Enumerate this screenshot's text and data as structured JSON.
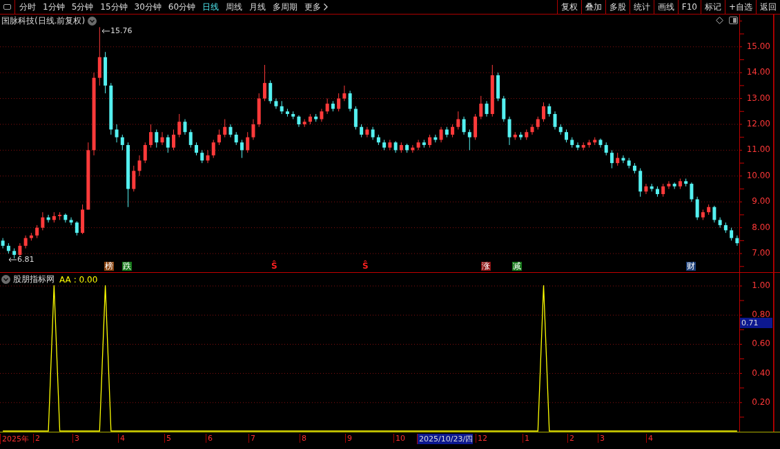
{
  "toolbar": {
    "periods": [
      {
        "label": "分时",
        "selected": false
      },
      {
        "label": "1分钟",
        "selected": false
      },
      {
        "label": "5分钟",
        "selected": false
      },
      {
        "label": "15分钟",
        "selected": false
      },
      {
        "label": "30分钟",
        "selected": false
      },
      {
        "label": "60分钟",
        "selected": false
      },
      {
        "label": "日线",
        "selected": true
      },
      {
        "label": "周线",
        "selected": false
      },
      {
        "label": "月线",
        "selected": false
      },
      {
        "label": "多周期",
        "selected": false
      }
    ],
    "more": "更多",
    "buttons": [
      "复权",
      "叠加",
      "多股",
      "统计",
      "画线",
      "F10",
      "标记",
      "+自选",
      "返回"
    ]
  },
  "main_chart": {
    "title": "国脉科技(日线.前复权)",
    "high_label": "15.76",
    "low_label": "6.81",
    "markers": [
      {
        "kind": "tag",
        "text": "榜",
        "color": "#8a4512"
      },
      {
        "kind": "tag",
        "text": "跌",
        "color": "#16781a"
      },
      {
        "kind": "sign",
        "text": "Ŝ"
      },
      {
        "kind": "sign",
        "text": "Ŝ"
      },
      {
        "kind": "tag",
        "text": "涨",
        "color": "#8c1414"
      },
      {
        "kind": "tag",
        "text": "减",
        "color": "#16781a"
      },
      {
        "kind": "tag",
        "text": "财",
        "color": "#1c3f78"
      }
    ],
    "chart_data": {
      "type": "candlestick",
      "categories": [
        null,
        null,
        null,
        null,
        null,
        null,
        null,
        null,
        null,
        null,
        null,
        null,
        null,
        null,
        null,
        null,
        null,
        null,
        null,
        null,
        null,
        null,
        null,
        null,
        null,
        null,
        null,
        null,
        null,
        null,
        null,
        null,
        null,
        null,
        null,
        null,
        null,
        null,
        null,
        null,
        null,
        null,
        null,
        null,
        null,
        null,
        null,
        null,
        null,
        null,
        null,
        null,
        null,
        null,
        null,
        null,
        null,
        null,
        null,
        null,
        null,
        null,
        null,
        null,
        null,
        null,
        null,
        null,
        null,
        null,
        null,
        null,
        null,
        null,
        null,
        null,
        null,
        null,
        null,
        null,
        null,
        null,
        null,
        null,
        null,
        null,
        null,
        null,
        null,
        null,
        null,
        null,
        null,
        null,
        null,
        null,
        null,
        null,
        null,
        null,
        null,
        null,
        null,
        null,
        null,
        null,
        null,
        null,
        null,
        null,
        null,
        null,
        null,
        null,
        null,
        null,
        null,
        null,
        null,
        null,
        null,
        null,
        null,
        null,
        null,
        null,
        null,
        null,
        null,
        null
      ],
      "ohlc": [
        [
          7.5,
          7.6,
          7.2,
          7.3
        ],
        [
          7.3,
          7.4,
          7.0,
          7.1
        ],
        [
          7.1,
          7.2,
          6.81,
          6.95
        ],
        [
          6.95,
          7.4,
          6.9,
          7.3
        ],
        [
          7.3,
          7.7,
          7.2,
          7.6
        ],
        [
          7.6,
          7.8,
          7.5,
          7.7
        ],
        [
          7.7,
          8.1,
          7.6,
          8.0
        ],
        [
          8.0,
          8.6,
          7.9,
          8.4
        ],
        [
          8.4,
          8.5,
          8.2,
          8.3
        ],
        [
          8.3,
          8.6,
          8.2,
          8.45
        ],
        [
          8.45,
          8.6,
          8.3,
          8.5
        ],
        [
          8.5,
          8.55,
          8.2,
          8.3
        ],
        [
          8.3,
          8.4,
          8.1,
          8.2
        ],
        [
          8.2,
          8.25,
          7.7,
          7.8
        ],
        [
          7.8,
          8.9,
          7.75,
          8.7
        ],
        [
          8.7,
          11.3,
          8.7,
          11.0
        ],
        [
          11.0,
          14.0,
          10.8,
          13.8
        ],
        [
          13.8,
          15.76,
          13.5,
          14.6
        ],
        [
          14.6,
          14.8,
          13.2,
          13.5
        ],
        [
          13.5,
          13.6,
          11.6,
          11.8
        ],
        [
          11.8,
          12.0,
          11.3,
          11.5
        ],
        [
          11.5,
          11.6,
          11.0,
          11.2
        ],
        [
          11.2,
          11.3,
          8.8,
          9.5
        ],
        [
          9.5,
          10.4,
          9.4,
          10.2
        ],
        [
          10.2,
          10.8,
          10.0,
          10.6
        ],
        [
          10.6,
          11.3,
          10.5,
          11.2
        ],
        [
          11.2,
          12.0,
          11.1,
          11.7
        ],
        [
          11.7,
          11.8,
          11.1,
          11.3
        ],
        [
          11.3,
          11.7,
          11.2,
          11.5
        ],
        [
          11.5,
          11.6,
          10.9,
          11.1
        ],
        [
          11.1,
          11.8,
          11.0,
          11.6
        ],
        [
          11.6,
          12.4,
          11.5,
          12.1
        ],
        [
          12.1,
          12.2,
          11.6,
          11.7
        ],
        [
          11.7,
          11.8,
          11.1,
          11.2
        ],
        [
          11.2,
          11.3,
          10.8,
          10.9
        ],
        [
          10.9,
          11.0,
          10.5,
          10.6
        ],
        [
          10.6,
          11.0,
          10.5,
          10.8
        ],
        [
          10.8,
          11.4,
          10.7,
          11.3
        ],
        [
          11.3,
          11.8,
          11.2,
          11.6
        ],
        [
          11.6,
          12.2,
          11.5,
          11.9
        ],
        [
          11.9,
          12.0,
          11.5,
          11.6
        ],
        [
          11.6,
          11.7,
          11.2,
          11.3
        ],
        [
          11.3,
          11.4,
          10.7,
          11.0
        ],
        [
          11.0,
          11.7,
          10.9,
          11.5
        ],
        [
          11.5,
          12.2,
          11.4,
          12.0
        ],
        [
          12.0,
          13.2,
          11.9,
          13.0
        ],
        [
          13.0,
          14.3,
          12.9,
          13.6
        ],
        [
          13.6,
          13.7,
          12.8,
          12.9
        ],
        [
          12.9,
          13.0,
          12.6,
          12.7
        ],
        [
          12.7,
          12.9,
          12.4,
          12.5
        ],
        [
          12.5,
          12.6,
          12.3,
          12.4
        ],
        [
          12.4,
          12.5,
          12.2,
          12.3
        ],
        [
          12.3,
          12.35,
          11.9,
          12.0
        ],
        [
          12.0,
          12.2,
          11.9,
          12.1
        ],
        [
          12.1,
          12.4,
          12.0,
          12.3
        ],
        [
          12.3,
          12.4,
          12.1,
          12.2
        ],
        [
          12.2,
          12.6,
          12.1,
          12.5
        ],
        [
          12.5,
          13.0,
          12.4,
          12.8
        ],
        [
          12.8,
          12.9,
          12.5,
          12.6
        ],
        [
          12.6,
          13.2,
          12.5,
          13.0
        ],
        [
          13.0,
          13.5,
          12.9,
          13.2
        ],
        [
          13.2,
          13.3,
          12.5,
          12.6
        ],
        [
          12.6,
          12.7,
          11.8,
          11.9
        ],
        [
          11.9,
          12.0,
          11.5,
          11.6
        ],
        [
          11.6,
          11.9,
          11.5,
          11.8
        ],
        [
          11.8,
          11.9,
          11.4,
          11.5
        ],
        [
          11.5,
          11.6,
          11.2,
          11.3
        ],
        [
          11.3,
          11.4,
          11.0,
          11.1
        ],
        [
          11.1,
          11.4,
          11.0,
          11.3
        ],
        [
          11.3,
          11.35,
          10.9,
          11.0
        ],
        [
          11.0,
          11.3,
          10.9,
          11.2
        ],
        [
          11.2,
          11.25,
          10.9,
          11.0
        ],
        [
          11.0,
          11.2,
          10.9,
          11.1
        ],
        [
          11.1,
          11.4,
          11.0,
          11.3
        ],
        [
          11.3,
          11.4,
          11.1,
          11.2
        ],
        [
          11.2,
          11.6,
          11.1,
          11.5
        ],
        [
          11.5,
          11.6,
          11.3,
          11.4
        ],
        [
          11.4,
          11.9,
          11.3,
          11.8
        ],
        [
          11.8,
          11.9,
          11.5,
          11.6
        ],
        [
          11.6,
          12.0,
          11.5,
          11.9
        ],
        [
          11.9,
          12.5,
          11.8,
          12.2
        ],
        [
          12.2,
          12.3,
          11.6,
          11.7
        ],
        [
          11.7,
          11.8,
          11.0,
          11.5
        ],
        [
          11.5,
          12.4,
          11.4,
          12.3
        ],
        [
          12.3,
          13.1,
          12.2,
          12.8
        ],
        [
          12.8,
          12.9,
          12.3,
          12.4
        ],
        [
          12.4,
          14.3,
          12.3,
          13.9
        ],
        [
          13.9,
          14.0,
          12.9,
          13.0
        ],
        [
          13.0,
          13.1,
          12.1,
          12.2
        ],
        [
          12.2,
          12.3,
          11.2,
          11.5
        ],
        [
          11.5,
          11.7,
          11.4,
          11.6
        ],
        [
          11.6,
          11.7,
          11.4,
          11.5
        ],
        [
          11.5,
          11.8,
          11.4,
          11.7
        ],
        [
          11.7,
          12.0,
          11.6,
          11.9
        ],
        [
          11.9,
          12.3,
          11.8,
          12.2
        ],
        [
          12.2,
          12.85,
          12.1,
          12.7
        ],
        [
          12.7,
          12.8,
          12.3,
          12.4
        ],
        [
          12.4,
          12.5,
          11.8,
          11.9
        ],
        [
          11.9,
          12.0,
          11.6,
          11.7
        ],
        [
          11.7,
          11.8,
          11.3,
          11.4
        ],
        [
          11.4,
          11.5,
          11.1,
          11.2
        ],
        [
          11.2,
          11.3,
          11.0,
          11.1
        ],
        [
          11.1,
          11.3,
          11.0,
          11.2
        ],
        [
          11.2,
          11.4,
          11.1,
          11.3
        ],
        [
          11.3,
          11.5,
          11.2,
          11.4
        ],
        [
          11.4,
          11.45,
          11.1,
          11.2
        ],
        [
          11.2,
          11.3,
          10.8,
          10.9
        ],
        [
          10.9,
          11.0,
          10.3,
          10.5
        ],
        [
          10.5,
          10.9,
          10.4,
          10.7
        ],
        [
          10.7,
          10.8,
          10.5,
          10.6
        ],
        [
          10.6,
          10.7,
          10.3,
          10.4
        ],
        [
          10.4,
          10.5,
          10.1,
          10.2
        ],
        [
          10.2,
          10.3,
          9.2,
          9.4
        ],
        [
          9.4,
          9.7,
          9.3,
          9.6
        ],
        [
          9.6,
          9.7,
          9.4,
          9.5
        ],
        [
          9.5,
          9.6,
          9.2,
          9.3
        ],
        [
          9.3,
          9.7,
          9.2,
          9.6
        ],
        [
          9.6,
          9.8,
          9.5,
          9.7
        ],
        [
          9.7,
          9.75,
          9.5,
          9.6
        ],
        [
          9.6,
          9.9,
          9.5,
          9.8
        ],
        [
          9.8,
          9.9,
          9.6,
          9.7
        ],
        [
          9.7,
          9.75,
          9.0,
          9.1
        ],
        [
          9.1,
          9.2,
          8.3,
          8.4
        ],
        [
          8.4,
          8.7,
          8.3,
          8.6
        ],
        [
          8.6,
          8.9,
          8.5,
          8.8
        ],
        [
          8.8,
          8.85,
          8.2,
          8.3
        ],
        [
          8.3,
          8.4,
          8.0,
          8.1
        ],
        [
          8.1,
          8.2,
          7.8,
          7.9
        ],
        [
          7.9,
          8.0,
          7.5,
          7.6
        ],
        [
          7.6,
          7.7,
          7.3,
          7.4
        ]
      ],
      "ylim": [
        6.28,
        16.25
      ],
      "grid": true,
      "yticks": [
        {
          "value": 15,
          "label": "15.00"
        },
        {
          "value": 14,
          "label": "14.00"
        },
        {
          "value": 13,
          "label": "13.00"
        },
        {
          "value": 12,
          "label": "12.00"
        },
        {
          "value": 11,
          "label": "11.00"
        },
        {
          "value": 10,
          "label": "10.00"
        },
        {
          "value": 9,
          "label": "9.00"
        },
        {
          "value": 8,
          "label": "8.00"
        },
        {
          "value": 7,
          "label": "7.00"
        }
      ]
    }
  },
  "indicator": {
    "name": "股朋指标网",
    "reading": ": 0.00",
    "cursor_value": "0.71",
    "chart_data": {
      "type": "line",
      "categories": [
        null,
        null,
        null,
        null,
        null,
        null,
        null,
        null,
        null,
        null,
        null,
        null,
        null,
        null,
        null,
        null,
        null,
        null,
        null,
        null,
        null,
        null,
        null,
        null,
        null,
        null,
        null,
        null,
        null,
        null,
        null,
        null,
        null,
        null,
        null,
        null,
        null,
        null,
        null,
        null,
        null,
        null,
        null,
        null,
        null,
        null,
        null,
        null,
        null,
        null,
        null,
        null,
        null,
        null,
        null,
        null,
        null,
        null,
        null,
        null,
        null,
        null,
        null,
        null,
        null,
        null,
        null,
        null,
        null,
        null,
        null,
        null,
        null,
        null,
        null,
        null,
        null,
        null,
        null,
        null,
        null,
        null,
        null,
        null,
        null,
        null,
        null,
        null,
        null,
        null,
        null,
        null,
        null,
        null,
        null,
        null,
        null,
        null,
        null,
        null,
        null,
        null,
        null,
        null,
        null,
        null,
        null,
        null,
        null,
        null,
        null,
        null,
        null,
        null,
        null,
        null,
        null,
        null,
        null,
        null,
        null,
        null,
        null,
        null,
        null,
        null,
        null,
        null,
        null,
        null
      ],
      "series": [
        {
          "name": "AA",
          "color": "#ffff00",
          "values": [
            0,
            0,
            0,
            0,
            0,
            0,
            0,
            0,
            0,
            1,
            0,
            0,
            0,
            0,
            0,
            0,
            0,
            0,
            1,
            0,
            0,
            0,
            0,
            0,
            0,
            0,
            0,
            0,
            0,
            0,
            0,
            0,
            0,
            0,
            0,
            0,
            0,
            0,
            0,
            0,
            0,
            0,
            0,
            0,
            0,
            0,
            0,
            0,
            0,
            0,
            0,
            0,
            0,
            0,
            0,
            0,
            0,
            0,
            0,
            0,
            0,
            0,
            0,
            0,
            0,
            0,
            0,
            0,
            0,
            0,
            0,
            0,
            0,
            0,
            0,
            0,
            0,
            0,
            0,
            0,
            0,
            0,
            0,
            0,
            0,
            0,
            0,
            0,
            0,
            0,
            0,
            0,
            0,
            0,
            0,
            1,
            0,
            0,
            0,
            0,
            0,
            0,
            0,
            0,
            0,
            0,
            0,
            0,
            0,
            0,
            0,
            0,
            0,
            0,
            0,
            0,
            0,
            0,
            0,
            0,
            0,
            0,
            0,
            0,
            0,
            0,
            0,
            0,
            0,
            0
          ]
        }
      ],
      "ylim": [
        0,
        1.09
      ],
      "grid": true,
      "yticks": [
        {
          "value": 0.2,
          "label": "0.20"
        },
        {
          "value": 0.4,
          "label": "0.40"
        },
        {
          "value": 0.6,
          "label": "0.60"
        },
        {
          "value": 0.8,
          "label": "0.80"
        },
        {
          "value": 1,
          "label": "1.00"
        }
      ]
    }
  },
  "date_axis": {
    "labels": [
      {
        "text": "2025年",
        "selected": false
      },
      {
        "text": "2",
        "selected": false
      },
      {
        "text": "3",
        "selected": false
      },
      {
        "text": "4",
        "selected": false
      },
      {
        "text": "5",
        "selected": false
      },
      {
        "text": "6",
        "selected": false
      },
      {
        "text": "7",
        "selected": false
      },
      {
        "text": "8",
        "selected": false
      },
      {
        "text": "9",
        "selected": false
      },
      {
        "text": "10",
        "selected": false
      },
      {
        "text": "2025/10/23/四",
        "selected": true
      },
      {
        "text": "12",
        "selected": false
      },
      {
        "text": "1",
        "selected": false
      },
      {
        "text": "2",
        "selected": false
      },
      {
        "text": "3",
        "selected": false
      },
      {
        "text": "4",
        "selected": false
      }
    ]
  }
}
